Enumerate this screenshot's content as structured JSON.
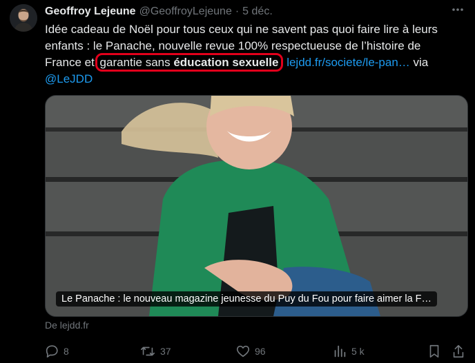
{
  "tweet": {
    "display_name": "Geoffroy Lejeune",
    "handle": "@GeoffroyLejeune",
    "separator": "·",
    "date": "5 déc.",
    "text_line1": "Idée cadeau de Noël pour tous ceux qui ne savent pas quoi faire lire à leurs",
    "text_line2": "enfants : le Panache, nouvelle revue 100% respectueuse de l’histoire de",
    "text_line3_prefix": "France et ",
    "highlight_plain": "garantie sans ",
    "highlight_bold": "éducation sexuelle",
    "link_text": "lejdd.fr/societe/le-pan…",
    "via_text": " via",
    "mention": "@LeJDD"
  },
  "card": {
    "caption": "Le Panache : le nouveau magazine jeunesse du Puy du Fou pour faire aimer la F…",
    "source": "De lejdd.fr"
  },
  "actions": {
    "replies": "8",
    "reposts": "37",
    "likes": "96",
    "views": "5 k"
  },
  "icons": {
    "more": "more-dots-icon",
    "reply": "reply-icon",
    "repost": "repost-icon",
    "like": "heart-icon",
    "views": "views-icon",
    "bookmark": "bookmark-icon",
    "share": "share-icon"
  },
  "colors": {
    "background": "#000000",
    "text": "#e7e9ea",
    "muted": "#71767b",
    "link": "#1d9bf0",
    "highlight_outline": "#e3001b"
  }
}
